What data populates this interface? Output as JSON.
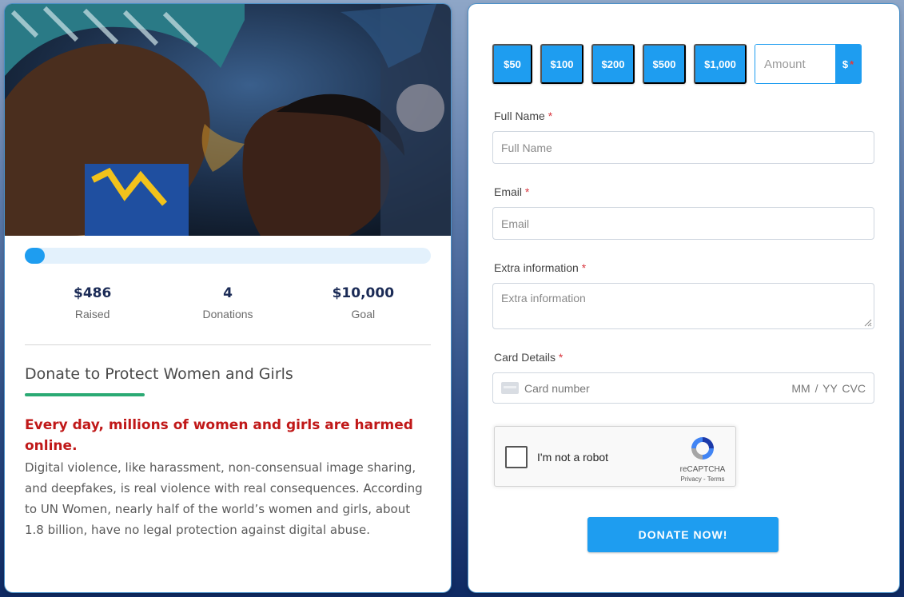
{
  "campaign": {
    "image_alt": "Mother and child",
    "progress_fraction": 0.0486,
    "stats": [
      {
        "value": "$486",
        "label": "Raised"
      },
      {
        "value": "4",
        "label": "Donations"
      },
      {
        "value": "$10,000",
        "label": "Goal"
      }
    ],
    "title": "Donate to Protect Women and Girls",
    "highlight": "Every day, millions of women and girls are harmed online.",
    "body": "Digital violence, like harassment, non-consensual image sharing, and deepfakes, is real violence with real consequences. According to UN Women, nearly half of the world’s women and girls, about 1.8 billion, have no legal protection against digital abuse."
  },
  "form": {
    "amounts": [
      "$50",
      "$100",
      "$200",
      "$500",
      "$1,000"
    ],
    "custom_amount_placeholder": "Amount",
    "currency": "$",
    "required_mark": "*",
    "full_name": {
      "label": "Full Name",
      "placeholder": "Full Name",
      "value": ""
    },
    "email": {
      "label": "Email",
      "placeholder": "Email",
      "value": ""
    },
    "extra": {
      "label": "Extra information",
      "placeholder": "Extra information",
      "value": ""
    },
    "card": {
      "label": "Card Details",
      "placeholder": "Card number",
      "extra": "MM / YY  CVC"
    },
    "recaptcha": {
      "label": "I'm not a robot",
      "brand": "reCAPTCHA",
      "links": "Privacy - Terms"
    },
    "submit_label": "DONATE NOW!"
  },
  "colors": {
    "accent": "#1e9df0",
    "accent_light": "#e3f1fc",
    "stat_value": "#1b2b56",
    "title_underline": "#2baa74",
    "highlight_red": "#c01818",
    "required": "#d9363e"
  }
}
